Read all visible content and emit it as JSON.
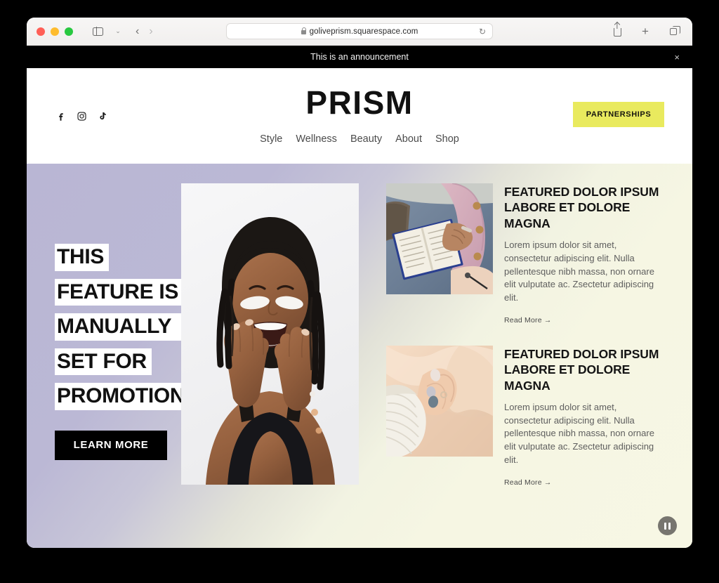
{
  "browser": {
    "url": "goliveprism.squarespace.com",
    "lock_icon": "lock-icon",
    "reload_icon": "↻",
    "back_icon": "‹",
    "forward_icon": "›",
    "sidebar_icon": "sidebar-icon",
    "chevron_icon": "⌄",
    "share_icon": "share-icon",
    "newtab_icon": "+",
    "tabs_icon": "tabs-overview-icon",
    "traffic_lights": [
      "close",
      "minimize",
      "zoom"
    ]
  },
  "announcement": {
    "text": "This is an announcement",
    "close_icon": "×"
  },
  "header": {
    "logo": "PRISM",
    "social": [
      {
        "name": "facebook-icon",
        "label": "Facebook"
      },
      {
        "name": "instagram-icon",
        "label": "Instagram"
      },
      {
        "name": "tiktok-icon",
        "label": "TikTok"
      }
    ],
    "nav": [
      {
        "label": "Style"
      },
      {
        "label": "Wellness"
      },
      {
        "label": "Beauty"
      },
      {
        "label": "About"
      },
      {
        "label": "Shop"
      }
    ],
    "cta": {
      "label": "PARTNERSHIPS",
      "background": "#e9ea5e",
      "color": "#16150f"
    }
  },
  "hero": {
    "gradient_from": "#b9b6d4",
    "gradient_to": "#f7f7e4",
    "headline_lines": [
      "THIS",
      "FEATURE IS",
      "MANUALLY",
      "SET FOR",
      "PROMOTION"
    ],
    "cta_label": "LEARN MORE",
    "image_alt": "Smiling woman with braids wearing white under-eye patches, hands on cheeks"
  },
  "features": [
    {
      "title": "FEATURED DOLOR IPSUM LABORE ET DOLORE MAGNA",
      "description": "Lorem ipsum dolor sit amet, consectetur adipiscing elit. Nulla pellentesque nibh massa, non ornare elit vulputate ac. Zsectetur adipiscing elit.",
      "link_label": "Read More",
      "link_arrow": "→",
      "image_alt": "Person in pink cardigan and blue jeans reading an open book"
    },
    {
      "title": "FEATURED DOLOR IPSUM LABORE ET DOLORE MAGNA",
      "description": "Lorem ipsum dolor sit amet, consectetur adipiscing elit. Nulla pellentesque nibh massa, non ornare elit vulputate ac. Zsectetur adipiscing elit.",
      "link_label": "Read More",
      "link_arrow": "→",
      "image_alt": "Hands against peach fabric beside a white knit sleeve"
    }
  ],
  "slideshow": {
    "pause_icon": "pause-icon",
    "state": "playing"
  }
}
